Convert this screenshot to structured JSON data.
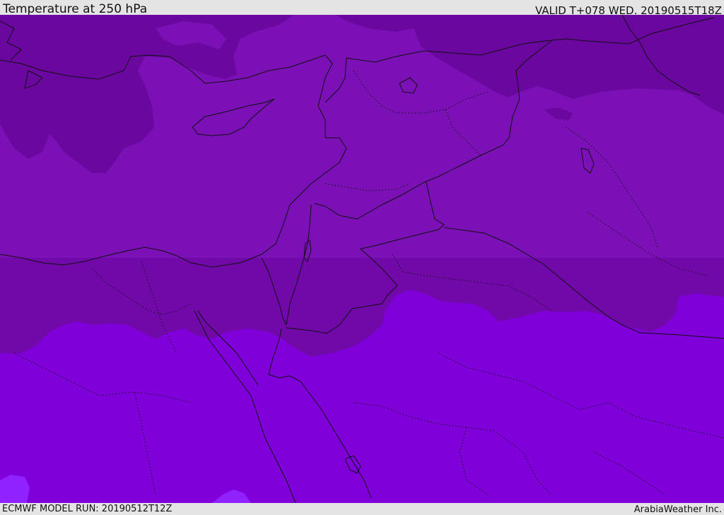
{
  "header": {
    "title": "Temperature at 250 hPa",
    "valid": "VALID T+078 WED. 20190515T18Z"
  },
  "footer": {
    "model_run": "ECMWF MODEL RUN: 20190512T12Z",
    "credit": "ArabiaWeather Inc."
  },
  "colors": {
    "band_coldest": "#6a079e",
    "band_cold": "#7a10b5",
    "band_mid": "#7108a8",
    "band_warm": "#7f00d8",
    "band_warmest": "#8f22ff",
    "boundary_line": "#111111"
  }
}
